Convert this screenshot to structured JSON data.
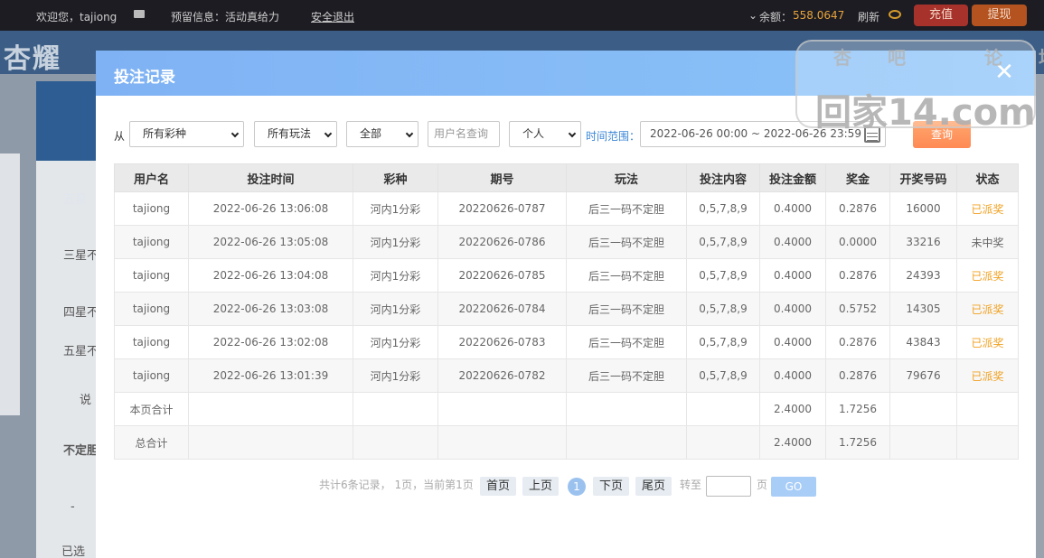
{
  "topbar": {
    "welcome": "欢迎您，tajiong",
    "reserved_info": "预留信息：活动真给力",
    "logout": "安全退出",
    "balance_label": "余额：",
    "balance_value": "558.0647",
    "refresh": "刷新",
    "recharge": "充值",
    "withdraw": "提现"
  },
  "background": {
    "logo": "杏耀",
    "side_texts": [
      "五星",
      "三星不",
      "四星不",
      "五星不",
      "说",
      "不定胆",
      "-",
      "已选"
    ]
  },
  "watermark": {
    "top": "杏吧 论坛",
    "main": "回家14.com"
  },
  "modal": {
    "title": "投注记录",
    "close": "✕"
  },
  "filters": {
    "from_label": "从",
    "lottery": "所有彩种",
    "play": "所有玩法",
    "scope": "全部",
    "username_placeholder": "用户名查询",
    "user_type": "个人",
    "range_label": "时间范围：",
    "range_value": "2022-06-26 00:00 ~ 2022-06-26 23:59",
    "query": "查询"
  },
  "table": {
    "headers": [
      "用户名",
      "投注时间",
      "彩种",
      "期号",
      "玩法",
      "投注内容",
      "投注金额",
      "奖金",
      "开奖号码",
      "状态"
    ],
    "rows": [
      [
        "tajiong",
        "2022-06-26 13:06:08",
        "河内1分彩",
        "20220626-0787",
        "后三一码不定胆",
        "0,5,7,8,9",
        "0.4000",
        "0.2876",
        "16000",
        "已派奖"
      ],
      [
        "tajiong",
        "2022-06-26 13:05:08",
        "河内1分彩",
        "20220626-0786",
        "后三一码不定胆",
        "0,5,7,8,9",
        "0.4000",
        "0.0000",
        "33216",
        "未中奖"
      ],
      [
        "tajiong",
        "2022-06-26 13:04:08",
        "河内1分彩",
        "20220626-0785",
        "后三一码不定胆",
        "0,5,7,8,9",
        "0.4000",
        "0.2876",
        "24393",
        "已派奖"
      ],
      [
        "tajiong",
        "2022-06-26 13:03:08",
        "河内1分彩",
        "20220626-0784",
        "后三一码不定胆",
        "0,5,7,8,9",
        "0.4000",
        "0.5752",
        "14305",
        "已派奖"
      ],
      [
        "tajiong",
        "2022-06-26 13:02:08",
        "河内1分彩",
        "20220626-0783",
        "后三一码不定胆",
        "0,5,7,8,9",
        "0.4000",
        "0.2876",
        "43843",
        "已派奖"
      ],
      [
        "tajiong",
        "2022-06-26 13:01:39",
        "河内1分彩",
        "20220626-0782",
        "后三一码不定胆",
        "0,5,7,8,9",
        "0.4000",
        "0.2876",
        "79676",
        "已派奖"
      ]
    ],
    "page_total_label": "本页合计",
    "page_total_amount": "2.4000",
    "page_total_bonus": "1.7256",
    "grand_total_label": "总合计",
    "grand_total_amount": "2.4000",
    "grand_total_bonus": "1.7256"
  },
  "pager": {
    "summary": "共计6条记录， 1页，当前第1页",
    "first": "首页",
    "prev": "上页",
    "current": "1",
    "next": "下页",
    "last": "尾页",
    "goto_label": "转至",
    "page_unit": "页",
    "go": "GO"
  },
  "colors": {
    "modal_header": "#8cc4f8",
    "query_button": "#ff8a55",
    "status_won": "#f0a020",
    "recharge": "#a7322b",
    "withdraw": "#b4531f"
  }
}
